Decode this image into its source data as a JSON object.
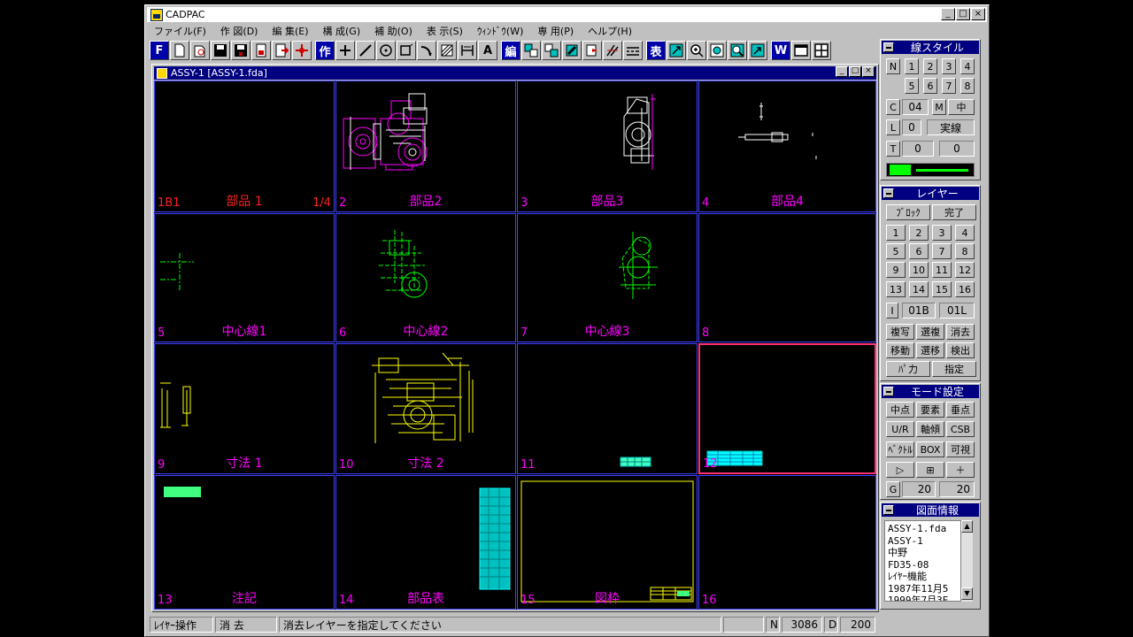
{
  "app": {
    "title": "CADPAC"
  },
  "menu": [
    "ファイル(F)",
    "作 図(D)",
    "編 集(E)",
    "構 成(G)",
    "補 助(O)",
    "表 示(S)",
    "ｳｨﾝﾄﾞｳ(W)",
    "専 用(P)",
    "ヘルプ(H)"
  ],
  "toolbar": {
    "f": "F",
    "text": "A",
    "saku": "作",
    "hen": "編",
    "hyou": "表",
    "w": "W"
  },
  "child": {
    "title": "ASSY-1 [ASSY-1.fda]"
  },
  "cells": [
    {
      "num": "1B1",
      "name": "部品 1",
      "page": "1/4"
    },
    {
      "num": "2",
      "name": "部品2"
    },
    {
      "num": "3",
      "name": "部品3"
    },
    {
      "num": "4",
      "name": "部品4"
    },
    {
      "num": "5",
      "name": "中心線1"
    },
    {
      "num": "6",
      "name": "中心線2"
    },
    {
      "num": "7",
      "name": "中心線3"
    },
    {
      "num": "8",
      "name": ""
    },
    {
      "num": "9",
      "name": "寸法 1"
    },
    {
      "num": "10",
      "name": "寸法 2"
    },
    {
      "num": "11",
      "name": ""
    },
    {
      "num": "12",
      "name": ""
    },
    {
      "num": "13",
      "name": "注記"
    },
    {
      "num": "14",
      "name": "部品表"
    },
    {
      "num": "15",
      "name": "図枠"
    },
    {
      "num": "16",
      "name": ""
    }
  ],
  "linestyle": {
    "title": "線スタイル",
    "row1": [
      "N",
      "1",
      "2",
      "3",
      "4"
    ],
    "row2": [
      "5",
      "6",
      "7",
      "8"
    ],
    "c_label": "C",
    "c_value": "04",
    "m_label": "M",
    "m_value": "中",
    "l_label": "L",
    "l_value": "0",
    "l_type": "実線",
    "t_label": "T",
    "t_value1": "0",
    "t_value2": "0",
    "color": "#00ff00"
  },
  "layer": {
    "title": "レイヤー",
    "block": "ﾌﾞﾛｯｸ",
    "done": "完了",
    "nums": [
      "1",
      "2",
      "3",
      "4",
      "5",
      "6",
      "7",
      "8",
      "9",
      "10",
      "11",
      "12",
      "13",
      "14",
      "15",
      "16"
    ],
    "i_label": "I",
    "v1": "01B",
    "v2": "01L",
    "actions": [
      "複写",
      "選複",
      "消去",
      "移動",
      "選移",
      "検出"
    ],
    "input": "ﾊﾟ力",
    "specify": "指定"
  },
  "mode": {
    "title": "モード設定",
    "row1": [
      "中点",
      "要素",
      "垂点"
    ],
    "row2": [
      "U/R",
      "軸傾",
      "CSB"
    ],
    "row3": [
      "ﾍﾞｸﾄﾙ",
      "BOX",
      "可視"
    ],
    "row4": [
      "▷",
      "⊞",
      "＋"
    ],
    "g_label": "G",
    "g1": "20",
    "g2": "20"
  },
  "info": {
    "title": "図面情報",
    "lines": [
      "ASSY-1.fda",
      "ASSY-1",
      "中野",
      "FD35-08",
      "ﾚｲﾔｰ機能",
      "1987年11月5",
      "1999年7月3E"
    ]
  },
  "status": {
    "op": "ﾚｲﾔｰ操作",
    "cmd": "消 去",
    "msg": "消去レイヤーを指定してください",
    "n_label": "N",
    "n_value": "3086",
    "d_label": "D",
    "d_value": "200"
  }
}
